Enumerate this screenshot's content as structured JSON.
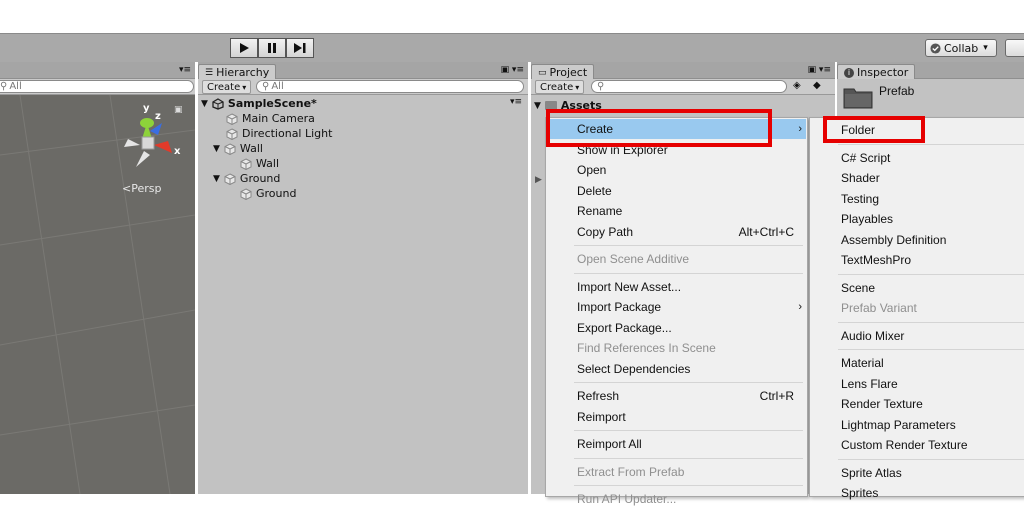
{
  "toolbar": {
    "collab_label": "Collab",
    "collab_check_icon": "check-circle-icon",
    "collab_arrow": "▾"
  },
  "scene": {
    "search_placeholder": "All",
    "persp_label": "<Persp",
    "axis_x": "x",
    "axis_y": "y",
    "axis_z": "z"
  },
  "hierarchy": {
    "tab_label": "Hierarchy",
    "create_label": "Create",
    "search_placeholder": "All",
    "items": [
      {
        "label": "SampleScene*",
        "level": 0,
        "expanded": true,
        "bold": true
      },
      {
        "label": "Main Camera",
        "level": 1
      },
      {
        "label": "Directional Light",
        "level": 1
      },
      {
        "label": "Wall",
        "level": 1,
        "expanded": true
      },
      {
        "label": "Wall",
        "level": 2
      },
      {
        "label": "Ground",
        "level": 1,
        "expanded": true
      },
      {
        "label": "Ground",
        "level": 2
      }
    ]
  },
  "project": {
    "tab_label": "Project",
    "create_label": "Create",
    "assets_label": "Assets"
  },
  "inspector": {
    "tab_label": "Inspector",
    "object_name": "Prefab"
  },
  "context_menu": {
    "items": [
      {
        "label": "Create",
        "submenu": true,
        "highlighted": true
      },
      {
        "label": "Show in Explorer"
      },
      {
        "label": "Open"
      },
      {
        "label": "Delete"
      },
      {
        "label": "Rename"
      },
      {
        "label": "Copy Path",
        "shortcut": "Alt+Ctrl+C"
      },
      {
        "separator": true
      },
      {
        "label": "Open Scene Additive",
        "disabled": true
      },
      {
        "separator": true
      },
      {
        "label": "Import New Asset..."
      },
      {
        "label": "Import Package",
        "submenu": true
      },
      {
        "label": "Export Package..."
      },
      {
        "label": "Find References In Scene",
        "disabled": true
      },
      {
        "label": "Select Dependencies"
      },
      {
        "separator": true
      },
      {
        "label": "Refresh",
        "shortcut": "Ctrl+R"
      },
      {
        "label": "Reimport"
      },
      {
        "separator": true
      },
      {
        "label": "Reimport All"
      },
      {
        "separator": true
      },
      {
        "label": "Extract From Prefab",
        "disabled": true
      },
      {
        "separator": true
      },
      {
        "label": "Run API Updater...",
        "disabled": true
      }
    ]
  },
  "create_submenu": {
    "items": [
      {
        "label": "Folder"
      },
      {
        "separator": true
      },
      {
        "label": "C# Script"
      },
      {
        "label": "Shader",
        "submenu": true
      },
      {
        "label": "Testing",
        "submenu": true
      },
      {
        "label": "Playables",
        "submenu": true
      },
      {
        "label": "Assembly Definition"
      },
      {
        "label": "TextMeshPro",
        "submenu": true
      },
      {
        "separator": true
      },
      {
        "label": "Scene"
      },
      {
        "label": "Prefab Variant",
        "disabled": true
      },
      {
        "separator": true
      },
      {
        "label": "Audio Mixer"
      },
      {
        "separator": true
      },
      {
        "label": "Material"
      },
      {
        "label": "Lens Flare"
      },
      {
        "label": "Render Texture"
      },
      {
        "label": "Lightmap Parameters"
      },
      {
        "label": "Custom Render Texture"
      },
      {
        "separator": true
      },
      {
        "label": "Sprite Atlas"
      },
      {
        "label": "Sprites",
        "submenu": true
      }
    ]
  },
  "colors": {
    "highlight": "#99c9ef",
    "annotation_red": "#e60000"
  }
}
